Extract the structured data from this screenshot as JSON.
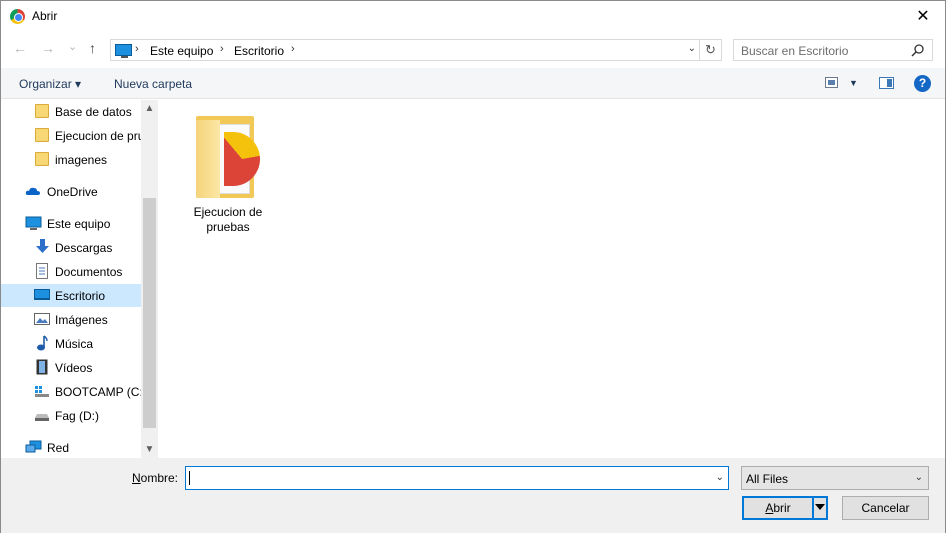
{
  "window": {
    "title": "Abrir",
    "close": "✕"
  },
  "nav": {
    "back": "←",
    "forward": "→",
    "recent": "⌄",
    "up": "↑"
  },
  "address": {
    "crumbs": [
      "Este equipo",
      "Escritorio"
    ],
    "separator": "›",
    "dropdown": "⌄",
    "refresh": "↻"
  },
  "search": {
    "placeholder": "Buscar en Escritorio"
  },
  "toolbar": {
    "organize": "Organizar ▾",
    "new_folder": "Nueva carpeta",
    "view_dropdown": "▼",
    "help": "?"
  },
  "sidebar": {
    "items": [
      {
        "label": "Base de datos",
        "icon": "folder-icon"
      },
      {
        "label": "Ejecucion de pru",
        "icon": "folder-icon"
      },
      {
        "label": "imagenes",
        "icon": "folder-icon"
      },
      {
        "label": "OneDrive",
        "icon": "cloud-icon"
      },
      {
        "label": "Este equipo",
        "icon": "computer-icon"
      },
      {
        "label": "Descargas",
        "icon": "download-icon"
      },
      {
        "label": "Documentos",
        "icon": "document-icon"
      },
      {
        "label": "Escritorio",
        "icon": "desktop-icon",
        "selected": true
      },
      {
        "label": "Imágenes",
        "icon": "pictures-icon"
      },
      {
        "label": "Música",
        "icon": "music-icon"
      },
      {
        "label": "Vídeos",
        "icon": "video-icon"
      },
      {
        "label": "BOOTCAMP (C:)",
        "icon": "drive-icon"
      },
      {
        "label": "Fag (D:)",
        "icon": "drive-icon"
      },
      {
        "label": "Red",
        "icon": "network-icon"
      }
    ],
    "scroll_up": "▲",
    "scroll_down": "▼"
  },
  "content": {
    "items": [
      {
        "label": "Ejecucion de pruebas",
        "icon": "folder-icon"
      }
    ]
  },
  "footer": {
    "name_label": "Nombre:",
    "name_value": "",
    "name_dropdown": "⌄",
    "file_type": "All Files",
    "file_type_dropdown": "⌄",
    "open_label": "Abrir",
    "cancel_label": "Cancelar"
  },
  "colors": {
    "accent": "#0078d7",
    "selected": "#cce8ff"
  }
}
